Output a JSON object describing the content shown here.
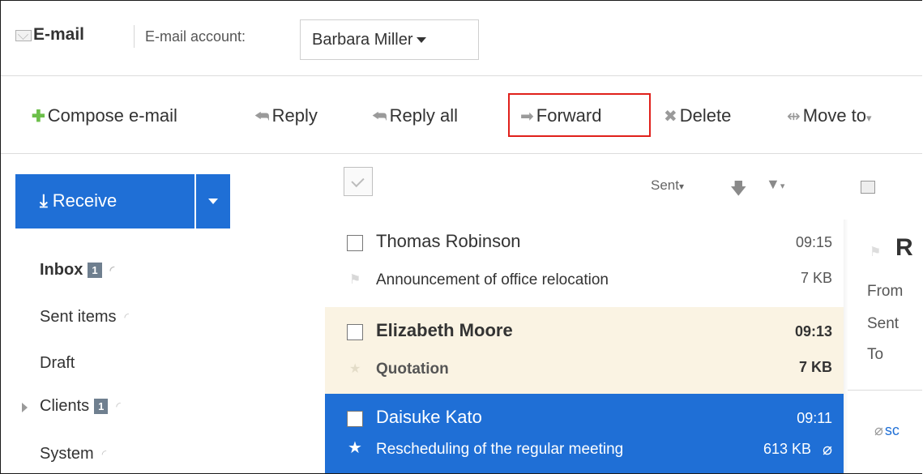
{
  "header": {
    "app_title": "E-mail",
    "account_label": "E-mail account:",
    "account_value": "Barbara Miller"
  },
  "toolbar": {
    "compose": "Compose e-mail",
    "reply": "Reply",
    "reply_all": "Reply all",
    "forward": "Forward",
    "delete": "Delete",
    "move_to": "Move to",
    "highlight_color": "#e0201b"
  },
  "sidebar": {
    "receive_label": "Receive",
    "folders": [
      {
        "label": "Inbox",
        "badge": "1"
      },
      {
        "label": "Sent items"
      },
      {
        "label": "Draft"
      },
      {
        "label": "Clients",
        "badge": "1"
      },
      {
        "label": "System"
      }
    ]
  },
  "list": {
    "sort_label": "Sent",
    "mails": [
      {
        "sender": "Thomas Robinson",
        "time": "09:15",
        "subject": "Announcement of office relocation",
        "size": "7 KB",
        "state": "read"
      },
      {
        "sender": "Elizabeth Moore",
        "time": "09:13",
        "subject": "Quotation",
        "size": "7 KB",
        "state": "unread"
      },
      {
        "sender": "Daisuke Kato",
        "time": "09:11",
        "subject": "Rescheduling of the regular meeting",
        "size": "613 KB",
        "state": "selected",
        "starred": true,
        "attachment": true
      }
    ]
  },
  "preview": {
    "title_partial": "R",
    "from_label": "From",
    "sent_label": "Sent",
    "to_label": "To",
    "attachment_partial": "sc"
  },
  "colors": {
    "accent": "#1f6fd6",
    "unread_row": "#faf3e3"
  }
}
